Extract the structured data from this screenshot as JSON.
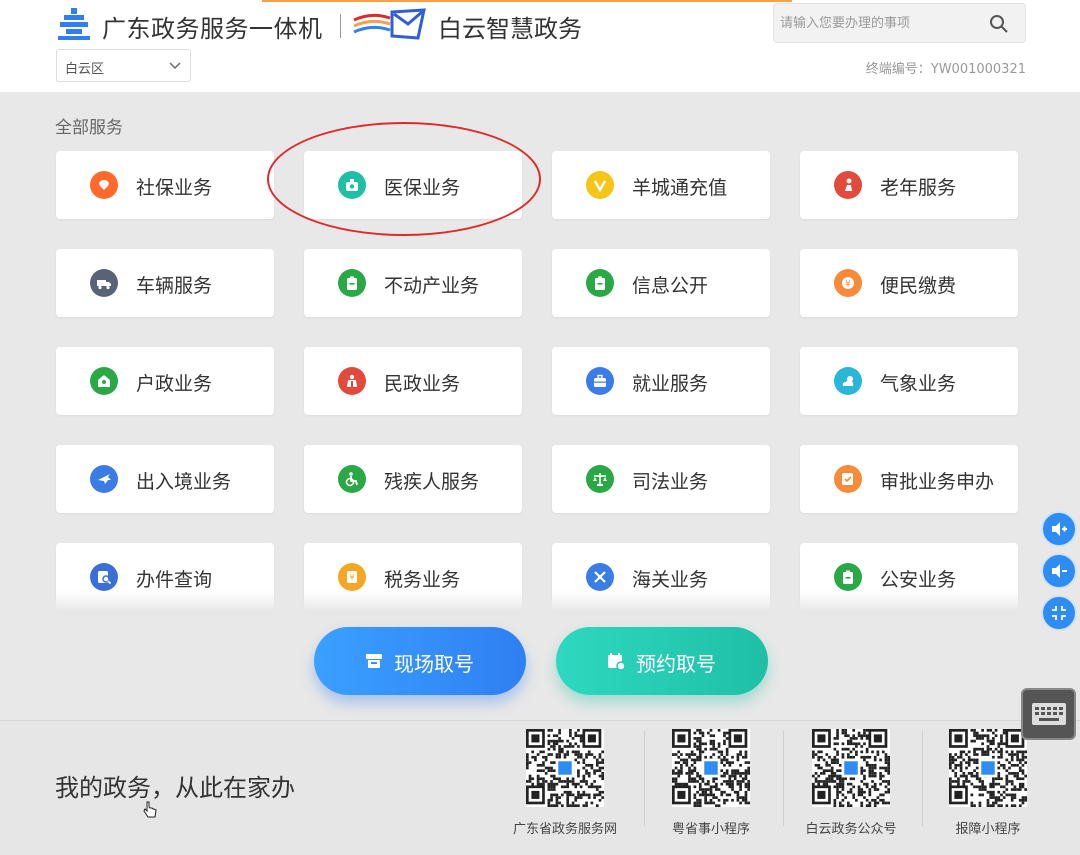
{
  "header": {
    "title": "广东政务服务一体机",
    "subtitle": "白云智慧政务",
    "search_placeholder": "请输入您要办理的事项",
    "district": "白云区",
    "terminal": "终端编号：YW001000321"
  },
  "section_label": "全部服务",
  "services": [
    {
      "label": "社保业务",
      "icon": "shebao-icon",
      "color": "#ff6a2c"
    },
    {
      "label": "医保业务",
      "icon": "yibao-icon",
      "color": "#1fbfa6"
    },
    {
      "label": "羊城通充值",
      "icon": "yangchengtong-icon",
      "color": "#f5c518"
    },
    {
      "label": "老年服务",
      "icon": "elderly-icon",
      "color": "#e24a3b"
    },
    {
      "label": "车辆服务",
      "icon": "vehicle-icon",
      "color": "#5a6278"
    },
    {
      "label": "不动产业务",
      "icon": "clipboard-icon",
      "color": "#2aa845"
    },
    {
      "label": "信息公开",
      "icon": "clipboard-icon",
      "color": "#2aa845"
    },
    {
      "label": "便民缴费",
      "icon": "payment-icon",
      "color": "#f78b3a"
    },
    {
      "label": "户政业务",
      "icon": "household-icon",
      "color": "#2aa845"
    },
    {
      "label": "民政业务",
      "icon": "civil-affairs-icon",
      "color": "#e24a3b"
    },
    {
      "label": "就业服务",
      "icon": "briefcase-icon",
      "color": "#3b7de6"
    },
    {
      "label": "气象业务",
      "icon": "weather-icon",
      "color": "#29b6d8"
    },
    {
      "label": "出入境业务",
      "icon": "airplane-icon",
      "color": "#3b7de6"
    },
    {
      "label": "残疾人服务",
      "icon": "wheelchair-icon",
      "color": "#2aa845"
    },
    {
      "label": "司法业务",
      "icon": "scales-icon",
      "color": "#2aa845"
    },
    {
      "label": "审批业务申办",
      "icon": "approval-icon",
      "color": "#f78b3a"
    },
    {
      "label": "办件查询",
      "icon": "query-icon",
      "color": "#3b6fd6"
    },
    {
      "label": "税务业务",
      "icon": "tax-icon",
      "color": "#f5a623"
    },
    {
      "label": "海关业务",
      "icon": "customs-icon",
      "color": "#3b7de6"
    },
    {
      "label": "公安业务",
      "icon": "police-icon",
      "color": "#2aa845"
    }
  ],
  "buttons": {
    "onsite": "现场取号",
    "appointment": "预约取号"
  },
  "footer": {
    "slogan": "我的政务，从此在家办",
    "qrcodes": [
      {
        "caption": "广东省政务服务网"
      },
      {
        "caption": "粤省事小程序"
      },
      {
        "caption": "白云政务公众号"
      },
      {
        "caption": "报障小程序"
      }
    ]
  }
}
